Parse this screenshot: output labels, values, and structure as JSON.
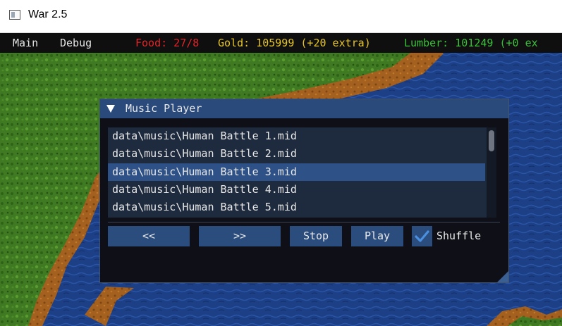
{
  "window": {
    "title": "War 2.5",
    "icon": "app-window-icon"
  },
  "menubar": {
    "items": [
      {
        "label": "Main"
      },
      {
        "label": "Debug"
      }
    ],
    "food": {
      "text": "Food: 27/8",
      "color": "#e0262a"
    },
    "gold": {
      "text": "Gold: 105999 (+20 extra)",
      "color": "#e6c52a"
    },
    "lumber": {
      "text": "Lumber: 101249 (+0 ex",
      "color": "#3cc03c"
    }
  },
  "music_player": {
    "title": "Music Player",
    "collapse_icon": "collapse-triangle-icon",
    "tracks": [
      "data\\music\\Human Battle 1.mid",
      "data\\music\\Human Battle 2.mid",
      "data\\music\\Human Battle 3.mid",
      "data\\music\\Human Battle 4.mid",
      "data\\music\\Human Battle 5.mid"
    ],
    "selected_index": 2,
    "buttons": {
      "prev": "<<",
      "next": ">>",
      "stop": "Stop",
      "play": "Play"
    },
    "shuffle": {
      "label": "Shuffle",
      "checked": true
    },
    "accent_color": "#2b4d7d"
  }
}
